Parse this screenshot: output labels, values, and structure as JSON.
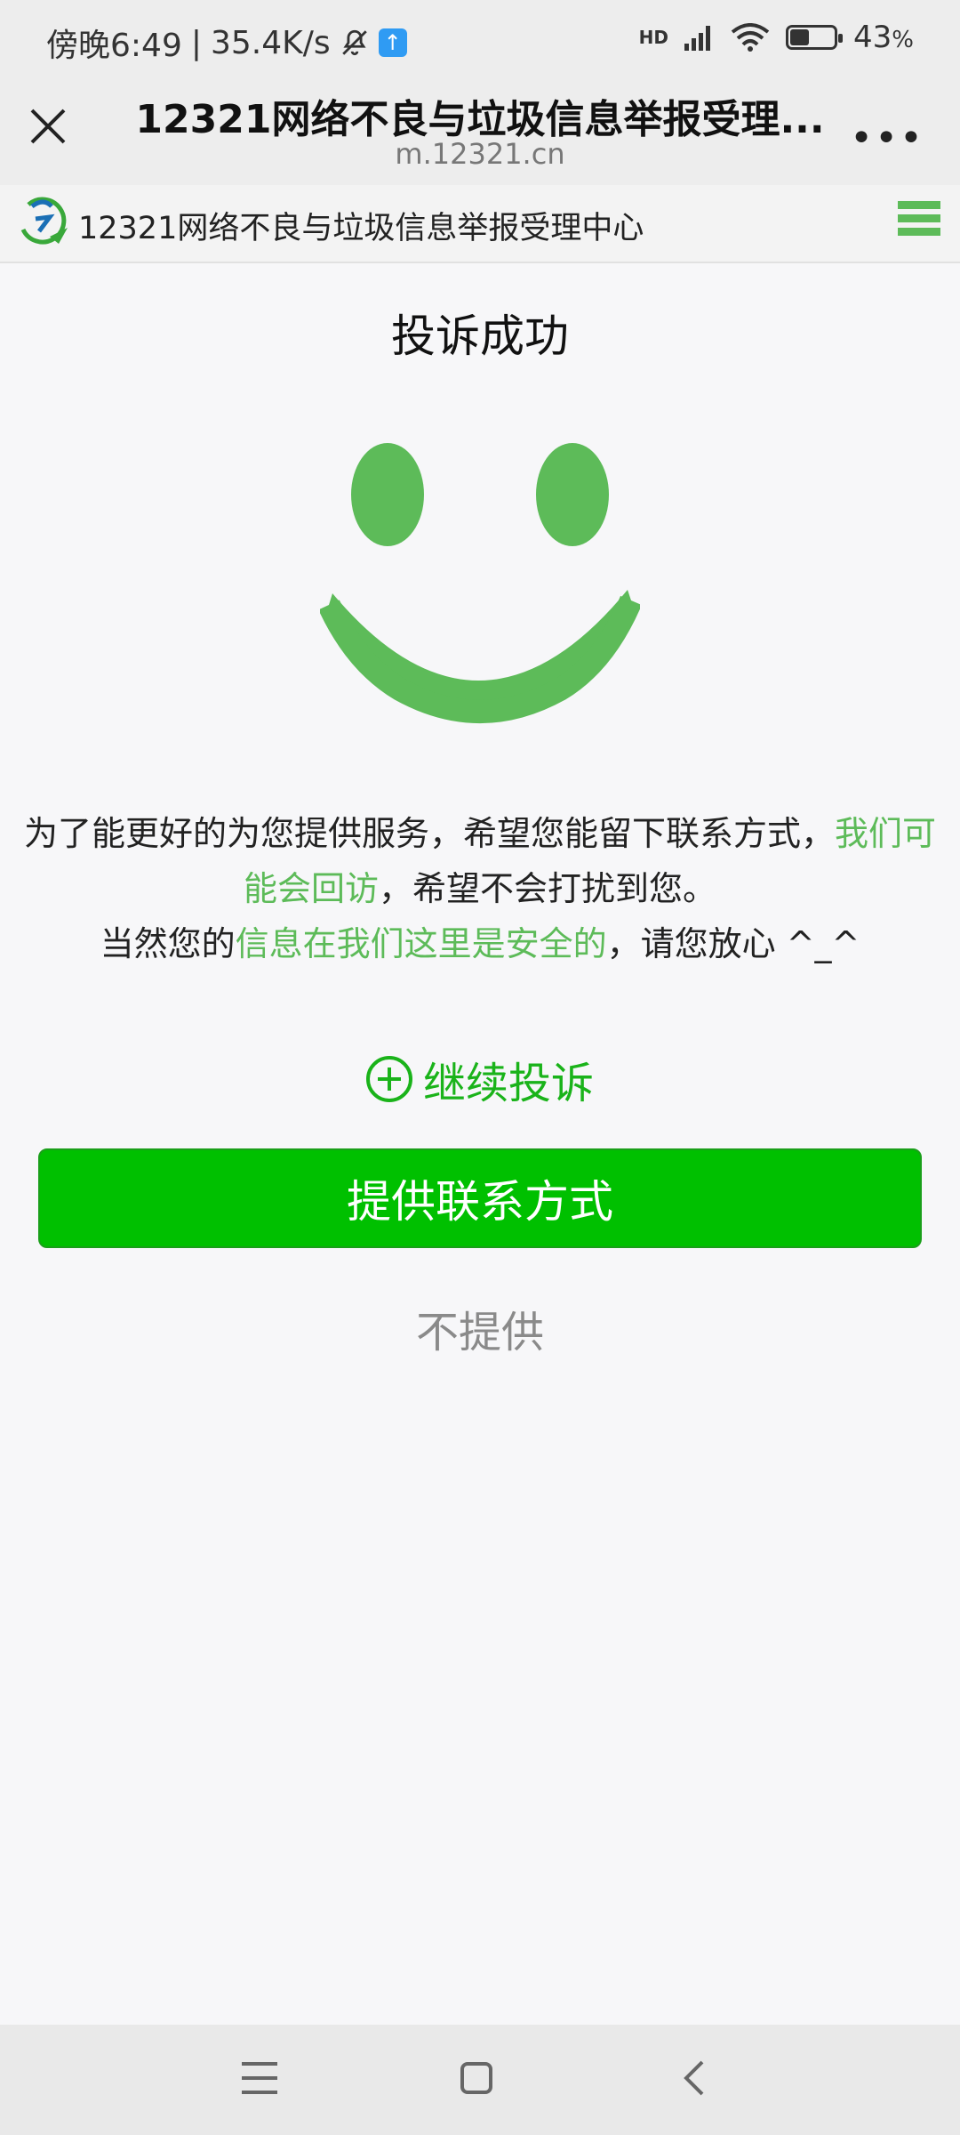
{
  "status_bar": {
    "time": "傍晚6:49",
    "speed": "35.4K/s",
    "network": "HD",
    "battery_percent": "43",
    "battery_suffix": "%"
  },
  "webview": {
    "title": "12321网络不良与垃圾信息举报受理...",
    "url": "m.12321.cn"
  },
  "site": {
    "name": "12321网络不良与垃圾信息举报受理中心"
  },
  "content": {
    "title": "投诉成功",
    "message": {
      "line1_prefix": "为了能更好的为您提供服务，希望您能留下联系方式，",
      "line1_green": "我们可能会回访",
      "line1_suffix": "，希望不会打扰到您。",
      "line2_prefix": "当然您的",
      "line2_green": "信息在我们这里是安全的",
      "line2_suffix": "，请您放心 ^_^"
    },
    "continue_label": "继续投诉",
    "provide_button": "提供联系方式",
    "decline_label": "不提供"
  },
  "colors": {
    "accent_green": "#5dbb59",
    "button_green": "#00c000",
    "link_green": "#1ab31a"
  }
}
